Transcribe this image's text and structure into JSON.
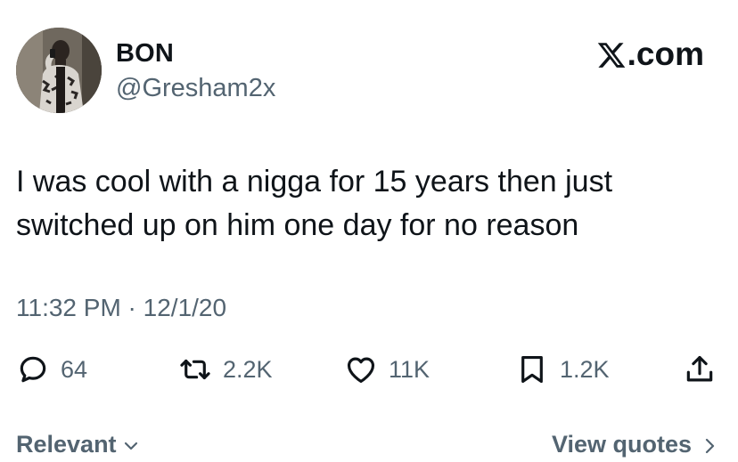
{
  "author": {
    "display_name": "BON",
    "handle": "@Gresham2x",
    "avatar_icon": "profile-photo"
  },
  "brand": {
    "label": ".com",
    "icon": "x-logo-icon"
  },
  "tweet": {
    "text": "I was cool with a nigga for 15 years then just switched up on him one day for no reason",
    "timestamp": "11:32 PM · 12/1/20"
  },
  "actions": {
    "reply": {
      "icon": "reply-icon",
      "count": "64"
    },
    "retweet": {
      "icon": "retweet-icon",
      "count": "2.2K"
    },
    "like": {
      "icon": "heart-icon",
      "count": "11K"
    },
    "bookmark": {
      "icon": "bookmark-icon",
      "count": "1.2K"
    },
    "share": {
      "icon": "share-icon"
    }
  },
  "footer": {
    "sort_label": "Relevant",
    "quotes_label": "View quotes"
  },
  "colors": {
    "text": "#0f1419",
    "secondary": "#536471",
    "background": "#ffffff"
  }
}
